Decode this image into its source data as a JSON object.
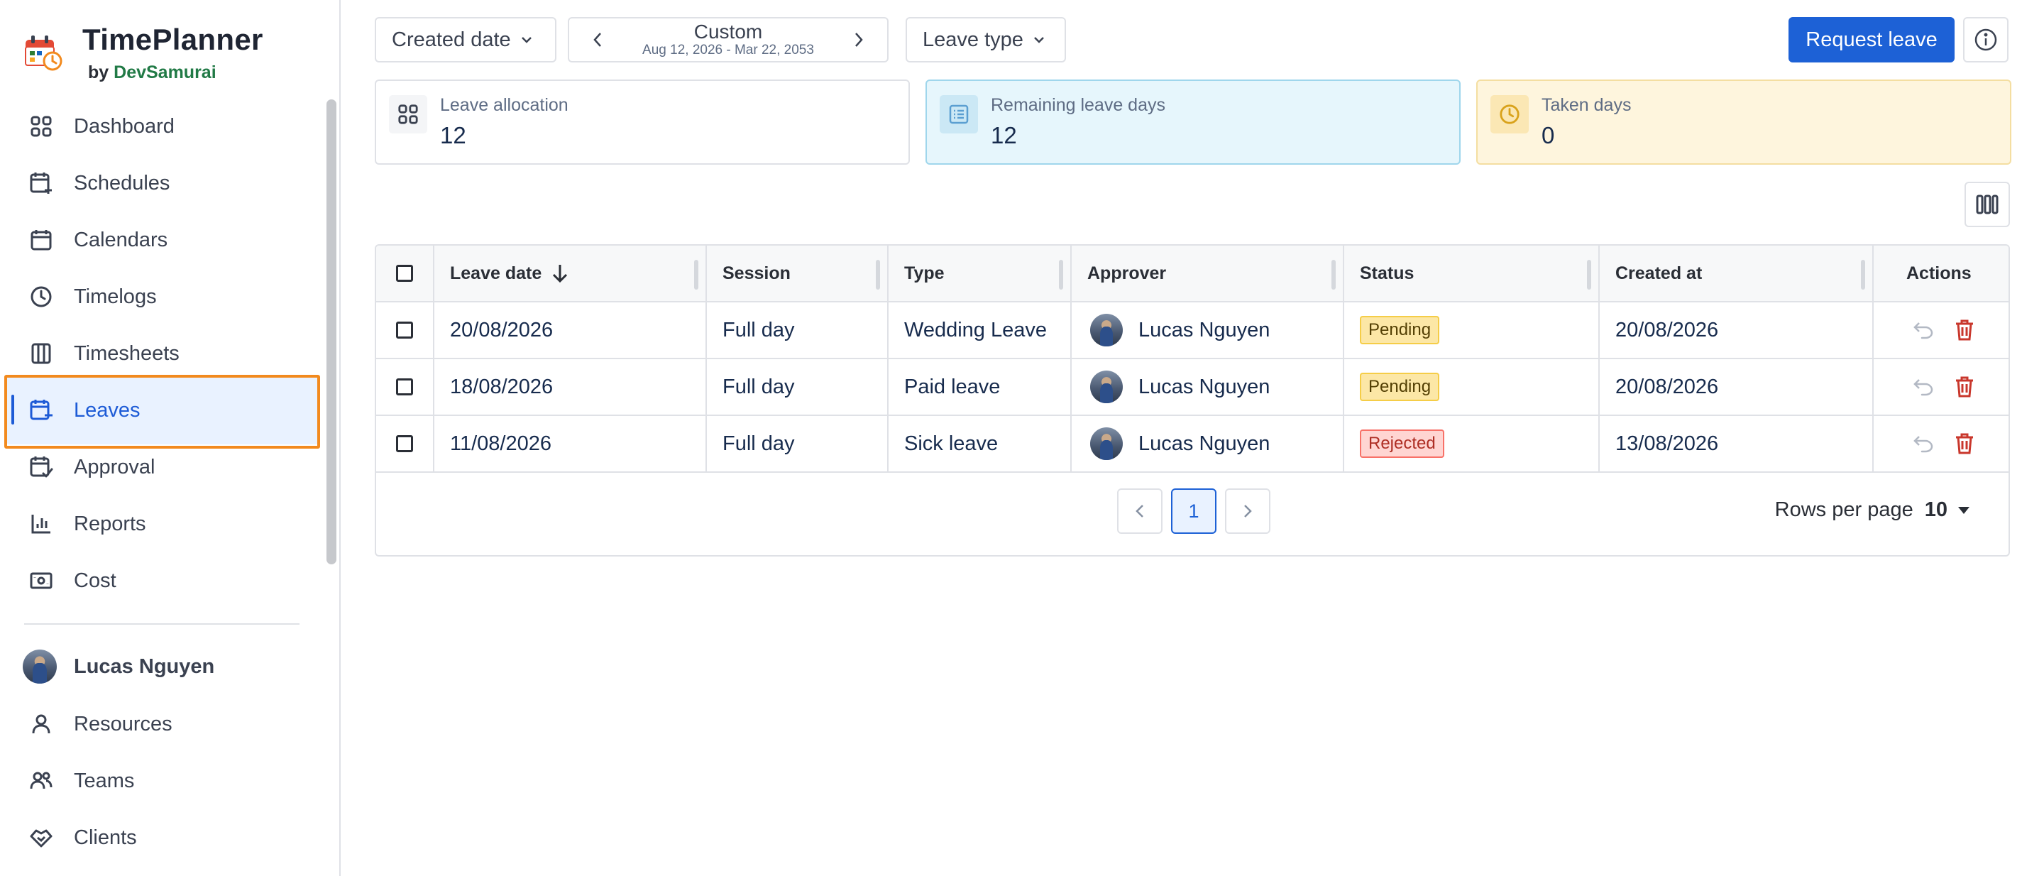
{
  "app": {
    "name": "TimePlanner",
    "by": "by",
    "vendor": "DevSamurai"
  },
  "sidebar": {
    "items": [
      {
        "label": "Dashboard",
        "icon": "grid-icon"
      },
      {
        "label": "Schedules",
        "icon": "calendar-plus-icon"
      },
      {
        "label": "Calendars",
        "icon": "calendar-icon"
      },
      {
        "label": "Timelogs",
        "icon": "clock-icon"
      },
      {
        "label": "Timesheets",
        "icon": "columns-icon"
      },
      {
        "label": "Leaves",
        "icon": "calendar-minus-icon",
        "active": true
      },
      {
        "label": "Approval",
        "icon": "calendar-check-icon"
      },
      {
        "label": "Reports",
        "icon": "bar-chart-icon"
      },
      {
        "label": "Cost",
        "icon": "money-icon"
      }
    ],
    "user": {
      "name": "Lucas Nguyen"
    },
    "bottom_items": [
      {
        "label": "Resources",
        "icon": "person-icon"
      },
      {
        "label": "Teams",
        "icon": "people-icon"
      },
      {
        "label": "Clients",
        "icon": "handshake-icon"
      }
    ]
  },
  "toolbar": {
    "created_date_label": "Created date",
    "date_mode": "Custom",
    "date_range": "Aug 12, 2026 - Mar 22, 2053",
    "leave_type_label": "Leave type",
    "request_leave_label": "Request leave"
  },
  "stats": {
    "allocation": {
      "label": "Leave allocation",
      "value": "12"
    },
    "remaining": {
      "label": "Remaining leave days",
      "value": "12"
    },
    "taken": {
      "label": "Taken days",
      "value": "0"
    }
  },
  "table": {
    "headers": {
      "leave_date": "Leave date",
      "session": "Session",
      "type": "Type",
      "approver": "Approver",
      "status": "Status",
      "created_at": "Created at",
      "actions": "Actions"
    },
    "rows": [
      {
        "leave_date": "20/08/2026",
        "session": "Full day",
        "type": "Wedding Leave",
        "approver": "Lucas Nguyen",
        "status": "Pending",
        "created_at": "20/08/2026"
      },
      {
        "leave_date": "18/08/2026",
        "session": "Full day",
        "type": "Paid leave",
        "approver": "Lucas Nguyen",
        "status": "Pending",
        "created_at": "20/08/2026"
      },
      {
        "leave_date": "11/08/2026",
        "session": "Full day",
        "type": "Sick leave",
        "approver": "Lucas Nguyen",
        "status": "Rejected",
        "created_at": "13/08/2026"
      }
    ]
  },
  "pagination": {
    "current_page": "1",
    "rows_per_page_label": "Rows per page",
    "rows_per_page_value": "10"
  },
  "colors": {
    "primary": "#1d61d6",
    "highlight": "#f28a1e",
    "pending": "#fce7a6",
    "rejected": "#ffd5d2",
    "delete": "#c9372c"
  }
}
